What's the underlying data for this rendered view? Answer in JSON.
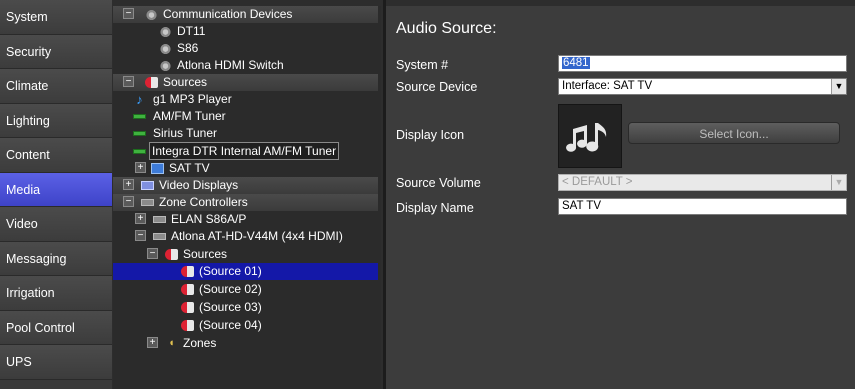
{
  "nav": {
    "items": [
      {
        "label": "System"
      },
      {
        "label": "Security"
      },
      {
        "label": "Climate"
      },
      {
        "label": "Lighting"
      },
      {
        "label": "Content"
      },
      {
        "label": "Media",
        "active": true
      },
      {
        "label": "Video"
      },
      {
        "label": "Messaging"
      },
      {
        "label": "Irrigation"
      },
      {
        "label": "Pool Control"
      },
      {
        "label": "UPS"
      }
    ]
  },
  "tree": {
    "comm_devices": "Communication Devices",
    "dt11": "DT11",
    "s86": "S86",
    "atlona_hdmi": "Atlona HDMI Switch",
    "sources": "Sources",
    "g1_mp3": "g1 MP3 Player",
    "amfm": "AM/FM Tuner",
    "sirius": "Sirius Tuner",
    "integra": "Integra DTR Internal AM/FM Tuner",
    "sat_tv": "SAT TV",
    "video_displays": "Video Displays",
    "zone_controllers": "Zone Controllers",
    "elan": "ELAN S86A/P",
    "atlona_v44m": "Atlona AT-HD-V44M (4x4 HDMI)",
    "zc_sources": "Sources",
    "src01": "(Source 01)",
    "src02": "(Source 02)",
    "src03": "(Source 03)",
    "src04": "(Source 04)",
    "zones": "Zones",
    "expand_glyph": "+",
    "collapse_glyph": "−"
  },
  "panel": {
    "title": "Audio Source:",
    "system_label": "System #",
    "system_value": "6481",
    "source_device_label": "Source Device",
    "source_device_value": "Interface: SAT TV",
    "display_icon_label": "Display Icon",
    "select_icon_button": "Select Icon...",
    "source_volume_label": "Source Volume",
    "source_volume_value": "< DEFAULT >",
    "display_name_label": "Display Name",
    "display_name_value": "SAT TV",
    "dropdown_glyph": "▼"
  },
  "colors": {
    "active_nav": "#4a50d8",
    "selected_row": "#1418a8",
    "panel_bg": "#3c3c3c"
  }
}
